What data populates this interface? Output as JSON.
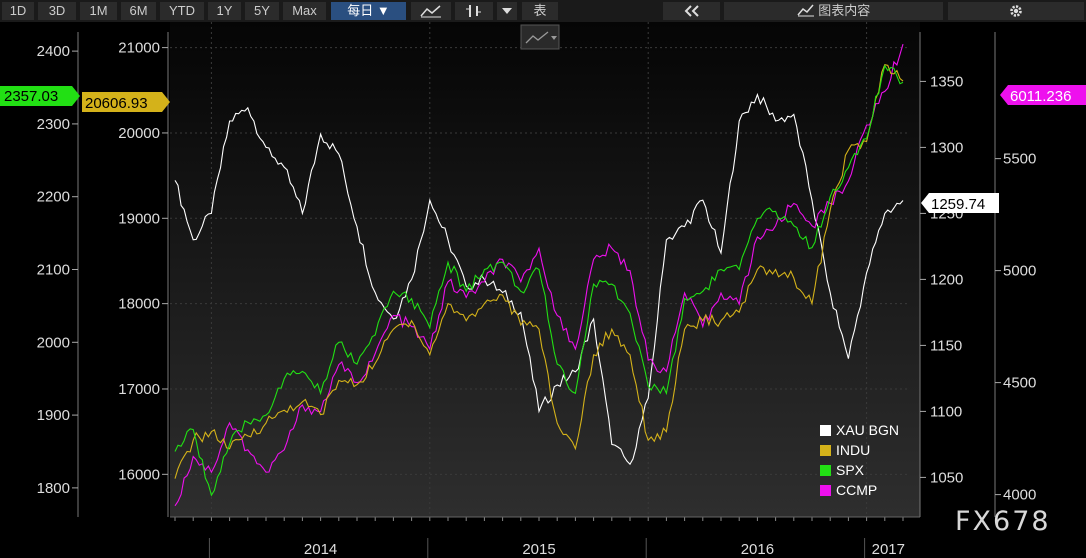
{
  "toolbar": {
    "ranges": [
      "1D",
      "3D",
      "1M",
      "6M",
      "YTD",
      "1Y",
      "5Y",
      "Max"
    ],
    "frequency": "每日 ▼",
    "table_label": "表",
    "chart_content_label": "图表内容",
    "collapse_icon": "double-chevron-left-icon",
    "settings_icon": "gear-icon"
  },
  "watermark": "FX678",
  "last_values": {
    "xau": "1259.74",
    "indu": "20606.93",
    "spx": "2357.03",
    "ccmp": "6011.236"
  },
  "colors": {
    "xau": "#ffffff",
    "indu": "#d4b21a",
    "spx": "#22e014",
    "ccmp": "#ee10ee",
    "background": "#000000"
  },
  "chart_data": {
    "type": "line",
    "x": [
      "2013-11",
      "2013-12",
      "2014-01",
      "2014-02",
      "2014-03",
      "2014-04",
      "2014-05",
      "2014-06",
      "2014-07",
      "2014-08",
      "2014-09",
      "2014-10",
      "2014-11",
      "2014-12",
      "2015-01",
      "2015-02",
      "2015-03",
      "2015-04",
      "2015-05",
      "2015-06",
      "2015-07",
      "2015-08",
      "2015-09",
      "2015-10",
      "2015-11",
      "2015-12",
      "2016-01",
      "2016-02",
      "2016-03",
      "2016-04",
      "2016-05",
      "2016-06",
      "2016-07",
      "2016-08",
      "2016-09",
      "2016-10",
      "2016-11",
      "2016-12",
      "2017-01",
      "2017-02",
      "2017-03"
    ],
    "x_tick_labels": [
      "2014",
      "2015",
      "2016",
      "2017"
    ],
    "legend_position": "bottom-right",
    "grid": true,
    "series": [
      {
        "name": "XAU BGN",
        "axis": "xau",
        "ylim": [
          1020,
          1395
        ],
        "ticks": [
          1050,
          1100,
          1150,
          1200,
          1250,
          1300,
          1350
        ],
        "values": [
          1275,
          1230,
          1250,
          1320,
          1330,
          1300,
          1285,
          1250,
          1310,
          1295,
          1240,
          1190,
          1170,
          1200,
          1260,
          1230,
          1195,
          1200,
          1190,
          1175,
          1100,
          1120,
          1130,
          1170,
          1075,
          1060,
          1110,
          1230,
          1240,
          1260,
          1220,
          1320,
          1340,
          1320,
          1325,
          1260,
          1190,
          1140,
          1205,
          1250,
          1259.74
        ]
      },
      {
        "name": "INDU",
        "axis": "indu",
        "ylim": [
          15500,
          21300
        ],
        "ticks": [
          16000,
          17000,
          18000,
          19000,
          20000,
          21000
        ],
        "values": [
          15950,
          16400,
          16500,
          16300,
          16450,
          16600,
          16750,
          16850,
          16700,
          17100,
          17050,
          17300,
          17700,
          17800,
          17400,
          18000,
          17800,
          18000,
          18100,
          17750,
          17700,
          16600,
          16300,
          17400,
          17700,
          17400,
          16400,
          16500,
          17700,
          17800,
          17800,
          17900,
          18400,
          18400,
          18300,
          18000,
          19100,
          19800,
          19900,
          20800,
          20606.93
        ]
      },
      {
        "name": "SPX",
        "axis": "spx",
        "ylim": [
          1760,
          2440
        ],
        "ticks": [
          1800,
          1900,
          2000,
          2100,
          2200,
          2300,
          2400
        ],
        "values": [
          1850,
          1880,
          1790,
          1860,
          1890,
          1900,
          1950,
          1960,
          1930,
          2000,
          1970,
          2010,
          2070,
          2060,
          2020,
          2110,
          2070,
          2100,
          2110,
          2070,
          2100,
          1970,
          1930,
          2080,
          2080,
          2040,
          1940,
          1930,
          2060,
          2070,
          2100,
          2100,
          2170,
          2180,
          2160,
          2130,
          2200,
          2240,
          2280,
          2380,
          2357.03
        ]
      },
      {
        "name": "CCMP",
        "axis": "ccmp",
        "ylim": [
          3900,
          6110
        ],
        "ticks": [
          4000,
          4500,
          5000,
          5500
        ],
        "values": [
          3950,
          4170,
          4100,
          4320,
          4200,
          4100,
          4200,
          4400,
          4370,
          4580,
          4500,
          4630,
          4800,
          4750,
          4650,
          4950,
          4880,
          4950,
          5050,
          4950,
          5100,
          4800,
          4650,
          5050,
          5100,
          5000,
          4600,
          4550,
          4900,
          4750,
          4900,
          4850,
          5150,
          5200,
          5300,
          5200,
          5300,
          5400,
          5650,
          5800,
          6011.236
        ]
      }
    ]
  }
}
